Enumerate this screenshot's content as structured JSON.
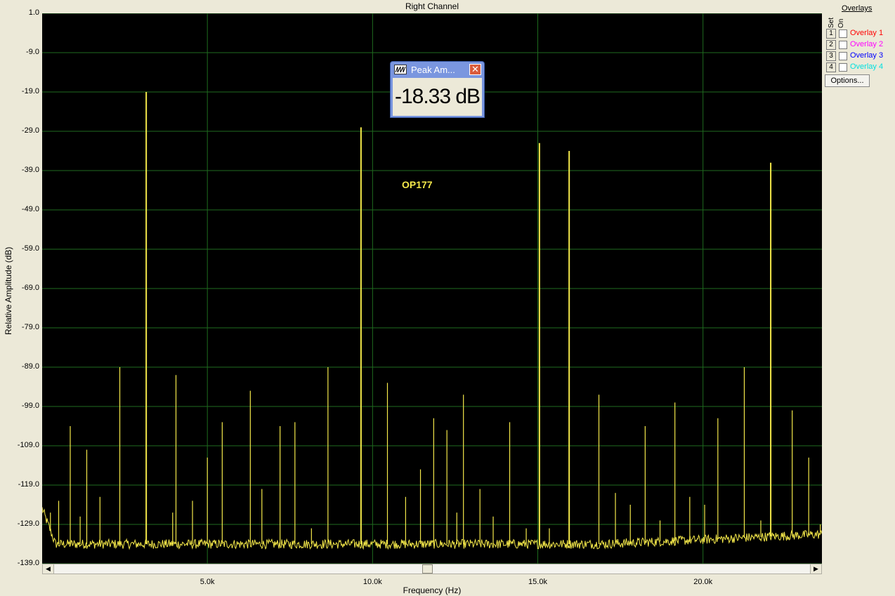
{
  "chart_data": {
    "type": "line",
    "title": "Right Channel",
    "xlabel": "Frequency (Hz)",
    "ylabel": "Relative Amplitude (dB)",
    "xlim": [
      0,
      23600
    ],
    "ylim": [
      -139,
      1
    ],
    "y_ticks": [
      "1.0",
      "-9.0",
      "-19.0",
      "-29.0",
      "-39.0",
      "-49.0",
      "-59.0",
      "-69.0",
      "-79.0",
      "-89.0",
      "-99.0",
      "-109.0",
      "-119.0",
      "-129.0",
      "-139.0"
    ],
    "x_ticks": [
      {
        "value": 5000,
        "label": "5.0k"
      },
      {
        "value": 10000,
        "label": "10.0k"
      },
      {
        "value": 15000,
        "label": "15.0k"
      },
      {
        "value": 20000,
        "label": "20.0k"
      }
    ],
    "grid": true,
    "trace_color": "#f4e84a",
    "noise_floor_db": -134,
    "peaks": [
      {
        "x": 3150,
        "y": -19
      },
      {
        "x": 9650,
        "y": -28
      },
      {
        "x": 15050,
        "y": -32
      },
      {
        "x": 15950,
        "y": -34
      },
      {
        "x": 22050,
        "y": -37
      },
      {
        "x": 2350,
        "y": -89
      },
      {
        "x": 4050,
        "y": -91
      },
      {
        "x": 6300,
        "y": -95
      },
      {
        "x": 8650,
        "y": -89
      },
      {
        "x": 10450,
        "y": -93
      },
      {
        "x": 12750,
        "y": -96
      },
      {
        "x": 16850,
        "y": -96
      },
      {
        "x": 19150,
        "y": -98
      },
      {
        "x": 21250,
        "y": -89
      },
      {
        "x": 22700,
        "y": -100
      },
      {
        "x": 850,
        "y": -104
      },
      {
        "x": 1350,
        "y": -110
      },
      {
        "x": 1750,
        "y": -122
      },
      {
        "x": 4550,
        "y": -123
      },
      {
        "x": 5000,
        "y": -112
      },
      {
        "x": 5450,
        "y": -103
      },
      {
        "x": 7200,
        "y": -104
      },
      {
        "x": 7650,
        "y": -103
      },
      {
        "x": 11850,
        "y": -102
      },
      {
        "x": 12250,
        "y": -105
      },
      {
        "x": 14150,
        "y": -103
      },
      {
        "x": 18250,
        "y": -104
      },
      {
        "x": 20450,
        "y": -102
      },
      {
        "x": 11000,
        "y": -122
      },
      {
        "x": 11450,
        "y": -115
      },
      {
        "x": 13250,
        "y": -120
      },
      {
        "x": 13650,
        "y": -127
      },
      {
        "x": 17350,
        "y": -121
      },
      {
        "x": 17800,
        "y": -124
      },
      {
        "x": 19600,
        "y": -122
      },
      {
        "x": 20050,
        "y": -124
      },
      {
        "x": 6650,
        "y": -120
      },
      {
        "x": 23200,
        "y": -112
      },
      {
        "x": 250,
        "y": -126
      },
      {
        "x": 500,
        "y": -123
      },
      {
        "x": 1150,
        "y": -127
      },
      {
        "x": 3950,
        "y": -126
      },
      {
        "x": 8150,
        "y": -130
      },
      {
        "x": 12550,
        "y": -126
      },
      {
        "x": 14650,
        "y": -130
      },
      {
        "x": 15350,
        "y": -130
      },
      {
        "x": 18700,
        "y": -128
      },
      {
        "x": 21750,
        "y": -128
      },
      {
        "x": 23550,
        "y": -129
      }
    ],
    "annotations": [
      {
        "text": "OP177",
        "color": "#f4e84a"
      }
    ]
  },
  "peak_window": {
    "title": "Peak Am...",
    "value": "-18.33 dB",
    "close_symbol": "✕"
  },
  "overlays": {
    "header": "Overlays",
    "set_label": "Set",
    "on_label": "On",
    "items": [
      {
        "num": "1",
        "label": "Overlay 1",
        "color": "#ff0000"
      },
      {
        "num": "2",
        "label": "Overlay 2",
        "color": "#ff00ff"
      },
      {
        "num": "3",
        "label": "Overlay 3",
        "color": "#0000ff"
      },
      {
        "num": "4",
        "label": "Overlay 4",
        "color": "#00e0e0"
      }
    ],
    "options_label": "Options..."
  },
  "scrollbar": {
    "left_arrow": "◀",
    "right_arrow": "▶"
  }
}
